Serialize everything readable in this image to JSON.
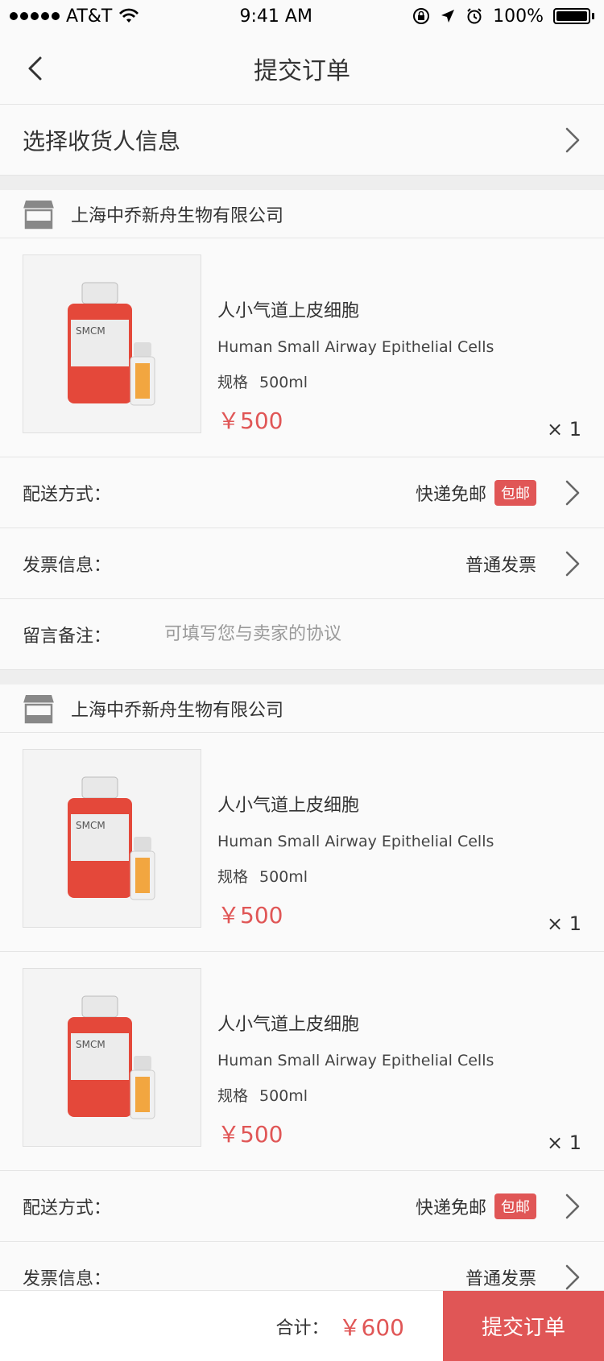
{
  "status": {
    "carrier": "AT&T",
    "time": "9:41 AM",
    "battery": "100%"
  },
  "nav": {
    "title": "提交订单"
  },
  "address": {
    "label": "选择收货人信息"
  },
  "orders": [
    {
      "shop": "上海中乔新舟生物有限公司",
      "products": [
        {
          "cn": "人小气道上皮细胞",
          "en": "Human Small Airway Epithelial Cells",
          "spec_label": "规格",
          "spec_value": "500ml",
          "price": "￥500",
          "qty": "× 1"
        }
      ],
      "delivery": {
        "label": "配送方式：",
        "value": "快递免邮",
        "badge": "包邮"
      },
      "invoice": {
        "label": "发票信息：",
        "value": "普通发票"
      },
      "note": {
        "label": "留言备注：",
        "placeholder": "可填写您与卖家的协议"
      }
    },
    {
      "shop": "上海中乔新舟生物有限公司",
      "products": [
        {
          "cn": "人小气道上皮细胞",
          "en": "Human Small Airway Epithelial Cells",
          "spec_label": "规格",
          "spec_value": "500ml",
          "price": "￥500",
          "qty": "× 1"
        },
        {
          "cn": "人小气道上皮细胞",
          "en": "Human Small Airway Epithelial Cells",
          "spec_label": "规格",
          "spec_value": "500ml",
          "price": "￥500",
          "qty": "× 1"
        }
      ],
      "delivery": {
        "label": "配送方式：",
        "value": "快递免邮",
        "badge": "包邮"
      },
      "invoice": {
        "label": "发票信息：",
        "value": "普通发票"
      }
    }
  ],
  "footer": {
    "total_label": "合计：",
    "total_value": "￥600",
    "submit_label": "提交订单"
  },
  "colors": {
    "accent": "#e05656",
    "divider": "#e5e5e5"
  }
}
